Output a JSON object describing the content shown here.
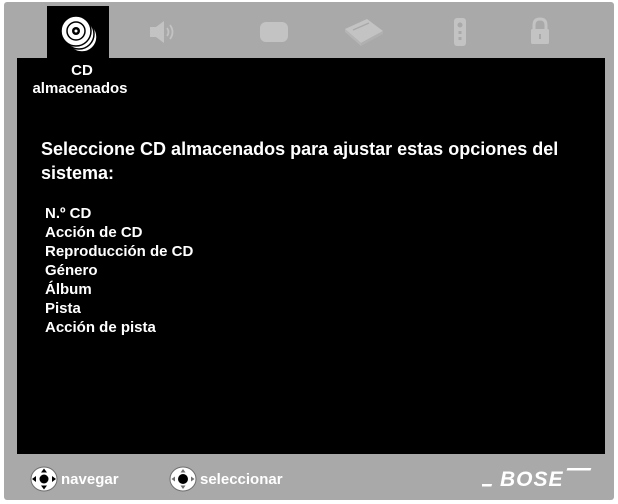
{
  "menu": {
    "name_line1": "CD",
    "name_line2": "almacenados"
  },
  "tabs": [
    {
      "icon": "stored-cds-icon",
      "active": true
    },
    {
      "icon": "speaker-icon",
      "active": false
    },
    {
      "icon": "display-icon",
      "active": false
    },
    {
      "icon": "disc-drive-icon",
      "active": false
    },
    {
      "icon": "remote-control-icon",
      "active": false
    },
    {
      "icon": "lock-icon",
      "active": false
    }
  ],
  "instruction": "Seleccione CD almacenados para ajustar estas opciones del sistema:",
  "options": [
    "N.º CD",
    "Acción de CD",
    "Reproducción de CD",
    "Género",
    "Álbum",
    "Pista",
    "Acción de pista"
  ],
  "footer": {
    "navigate_label": "navegar",
    "select_label": "seleccionar",
    "brand": "BOSE"
  },
  "colors": {
    "frame": "#a9a9a9",
    "screen": "#000000",
    "text": "#ffffff",
    "inactive_icon": "#c3c3c3"
  }
}
